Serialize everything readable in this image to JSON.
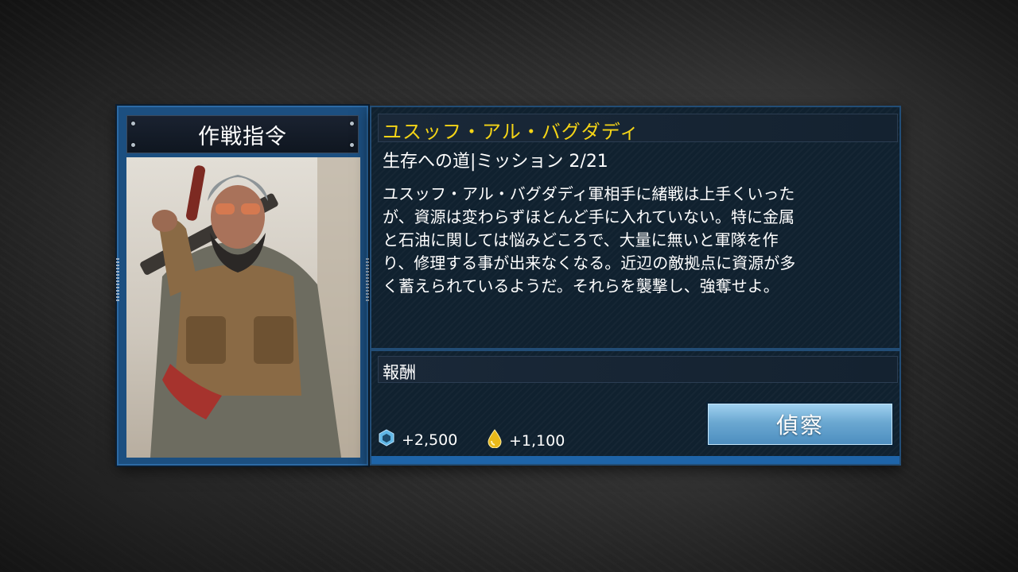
{
  "card": {
    "header": "作戦指令",
    "mission_name": "ユスッフ・アル・バグダディ",
    "subtitle": "生存への道|ミッション 2/21",
    "description": "ユスッフ・アル・バグダディ軍相手に緒戦は上手くいった\nが、資源は変わらずほとんど手に入れていない。特に金属\nと石油に関しては悩みどころで、大量に無いと軍隊を作\nり、修理する事が出来なくなる。近辺の敵拠点に資源が多\nく蓄えられているようだ。それらを襲撃し、強奪せよ。"
  },
  "rewards": {
    "label": "報酬",
    "items": [
      {
        "icon": "metal-icon",
        "value": "+2,500"
      },
      {
        "icon": "oil-drop-icon",
        "value": "+1,100"
      }
    ]
  },
  "actions": {
    "scout_label": "偵察"
  },
  "colors": {
    "mission_name": "#f4d417",
    "panel_border": "#1c4f80",
    "button": "#6ba8d1"
  }
}
